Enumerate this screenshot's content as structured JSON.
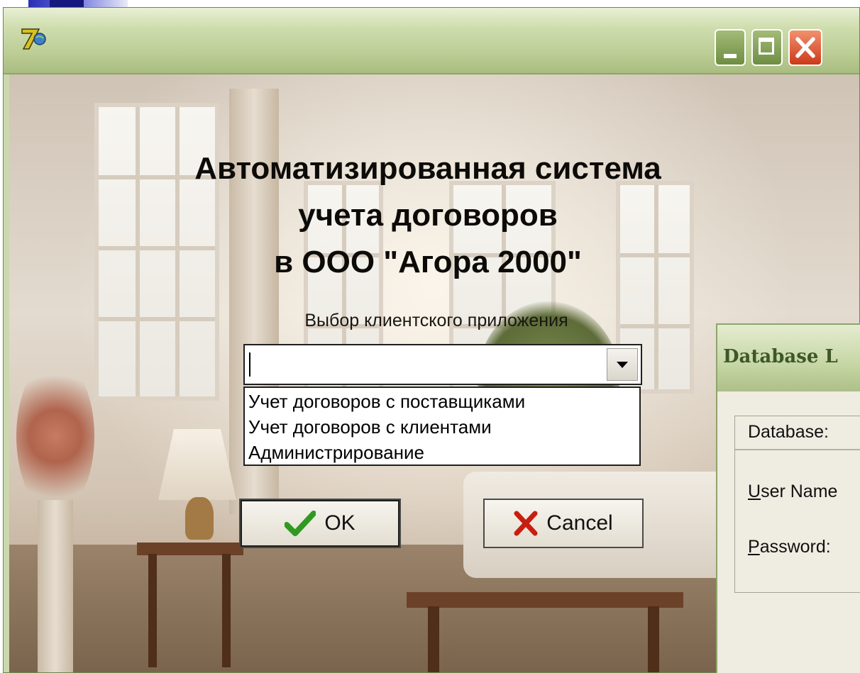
{
  "heading": {
    "line1": "Автоматизированная система",
    "line2": "учета договоров",
    "line3": "в ООО \"Агора 2000\""
  },
  "app_select": {
    "label": "Выбор клиентского приложения",
    "value": "",
    "options": [
      "Учет договоров с поставщиками",
      "Учет договоров с клиентами",
      "Администрирование"
    ]
  },
  "buttons": {
    "ok_label": "OK",
    "cancel_label": "Cancel"
  },
  "login_dialog": {
    "title": "Database L",
    "database_label": "Database:",
    "username_label_mnemonic": "U",
    "username_label_rest": "ser Name",
    "password_label_mnemonic": "P",
    "password_label_rest": "assword:"
  },
  "icons": {
    "app": "app-logo-icon",
    "ok": "checkmark-icon",
    "cancel": "red-x-icon"
  },
  "colors": {
    "titlebar": "#bccd95",
    "close_button": "#cc3a1a",
    "ok_check": "#2f9a1f",
    "cancel_x": "#c81e12"
  }
}
